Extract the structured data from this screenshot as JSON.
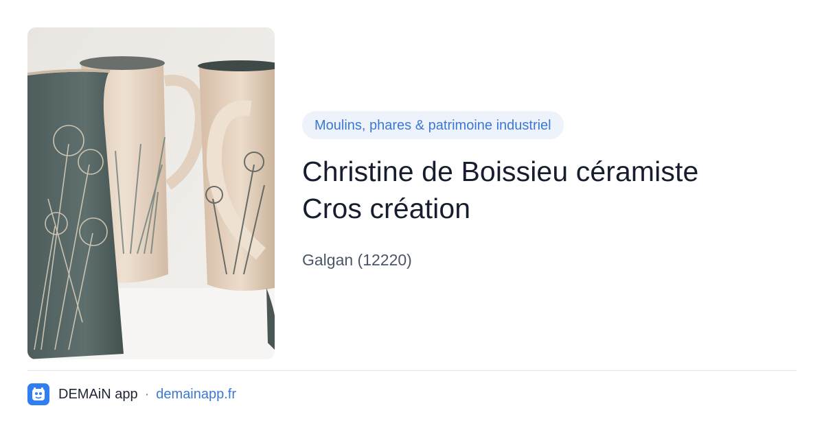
{
  "card": {
    "category": "Moulins, phares & patrimoine industriel",
    "title_lines": [
      "Christine de Boissieu céramiste",
      "Cros création"
    ],
    "location": "Galgan (12220)"
  },
  "footer": {
    "app_name": "DEMAiN app",
    "separator": "·",
    "site": "demainapp.fr"
  },
  "colors": {
    "accent": "#3a78d4",
    "pill_bg": "#eef3fb",
    "title": "#161d2e",
    "app_icon": "#2f7ff0"
  },
  "icons": {
    "app_logo": "demain-logo-icon"
  },
  "image": {
    "subject": "ceramic-pitchers-photo"
  }
}
